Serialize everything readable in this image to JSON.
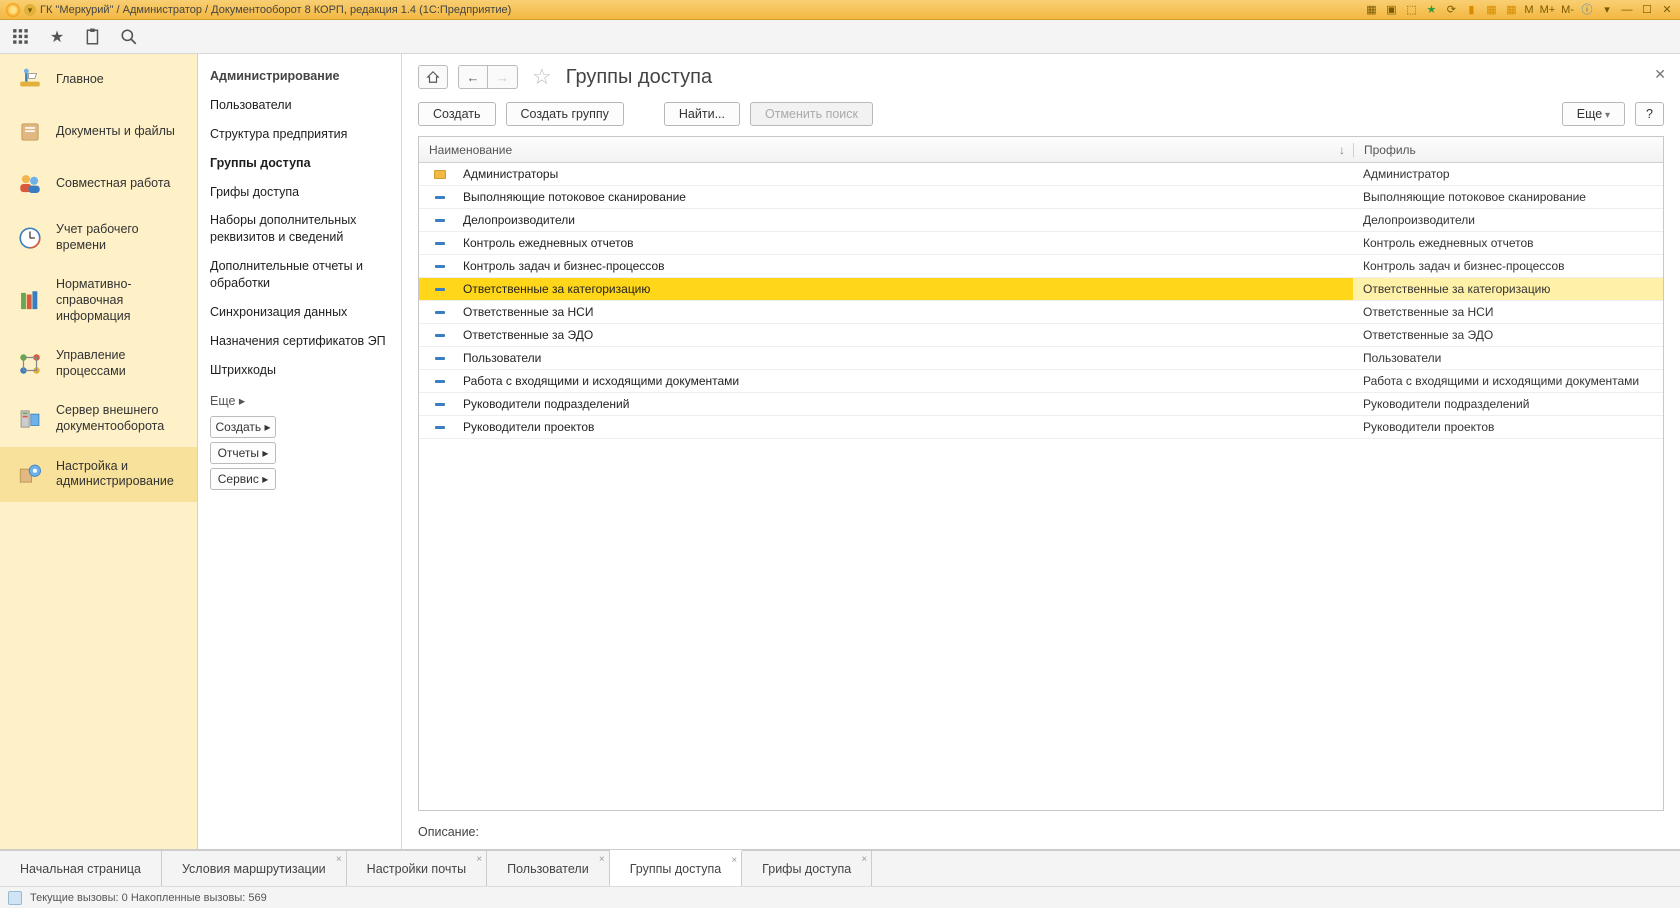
{
  "titleBar": {
    "text": "ГК \"Меркурий\" / Администратор / Документооборот 8 КОРП, редакция 1.4  (1С:Предприятие)",
    "rightLabels": [
      "M",
      "M+",
      "M-"
    ]
  },
  "navItems": [
    {
      "label": "Главное"
    },
    {
      "label": "Документы и файлы"
    },
    {
      "label": "Совместная работа"
    },
    {
      "label": "Учет рабочего времени"
    },
    {
      "label": "Нормативно-справочная информация"
    },
    {
      "label": "Управление процессами"
    },
    {
      "label": "Сервер внешнего документооборота"
    },
    {
      "label": "Настройка и администрирование"
    }
  ],
  "subnav": {
    "section": "Администрирование",
    "items": [
      "Пользователи",
      "Структура предприятия",
      "Группы доступа",
      "Грифы доступа",
      "Наборы дополнительных реквизитов и сведений",
      "Дополнительные отчеты и обработки",
      "Синхронизация данных",
      "Назначения сертификатов ЭП",
      "Штрихкоды"
    ],
    "more": "Еще ▸",
    "buttons": [
      "Создать ▸",
      "Отчеты ▸",
      "Сервис ▸"
    ]
  },
  "page": {
    "title": "Группы доступа",
    "actions": {
      "create": "Создать",
      "createGroup": "Создать группу",
      "find": "Найти...",
      "cancelFind": "Отменить поиск",
      "more": "Еще",
      "help": "?"
    },
    "columns": {
      "name": "Наименование",
      "profile": "Профиль",
      "sort": "↓"
    },
    "rows": [
      {
        "icon": "folder",
        "name": "Администраторы",
        "profile": "Администратор"
      },
      {
        "icon": "dash",
        "name": "Выполняющие потоковое сканирование",
        "profile": "Выполняющие потоковое сканирование"
      },
      {
        "icon": "dash",
        "name": "Делопроизводители",
        "profile": "Делопроизводители"
      },
      {
        "icon": "dash",
        "name": "Контроль ежедневных отчетов",
        "profile": "Контроль ежедневных отчетов"
      },
      {
        "icon": "dash",
        "name": "Контроль задач и бизнес-процессов",
        "profile": "Контроль задач и бизнес-процессов"
      },
      {
        "icon": "dash",
        "name": "Ответственные за категоризацию",
        "profile": "Ответственные за категоризацию",
        "selected": true
      },
      {
        "icon": "dash",
        "name": "Ответственные за НСИ",
        "profile": "Ответственные за НСИ"
      },
      {
        "icon": "dash",
        "name": "Ответственные за ЭДО",
        "profile": "Ответственные за ЭДО"
      },
      {
        "icon": "dash",
        "name": "Пользователи",
        "profile": "Пользователи"
      },
      {
        "icon": "dash",
        "name": "Работа с входящими и исходящими документами",
        "profile": "Работа с входящими и исходящими документами"
      },
      {
        "icon": "dash",
        "name": "Руководители подразделений",
        "profile": "Руководители подразделений"
      },
      {
        "icon": "dash",
        "name": "Руководители проектов",
        "profile": "Руководители проектов"
      }
    ],
    "descLabel": "Описание:"
  },
  "tabs": [
    {
      "label": "Начальная страница",
      "closable": false
    },
    {
      "label": "Условия маршрутизации",
      "closable": true
    },
    {
      "label": "Настройки почты",
      "closable": true
    },
    {
      "label": "Пользователи",
      "closable": true
    },
    {
      "label": "Группы доступа",
      "closable": true,
      "active": true
    },
    {
      "label": "Грифы доступа",
      "closable": true
    }
  ],
  "status": {
    "text": "Текущие вызовы: 0  Накопленные вызовы: 569"
  }
}
